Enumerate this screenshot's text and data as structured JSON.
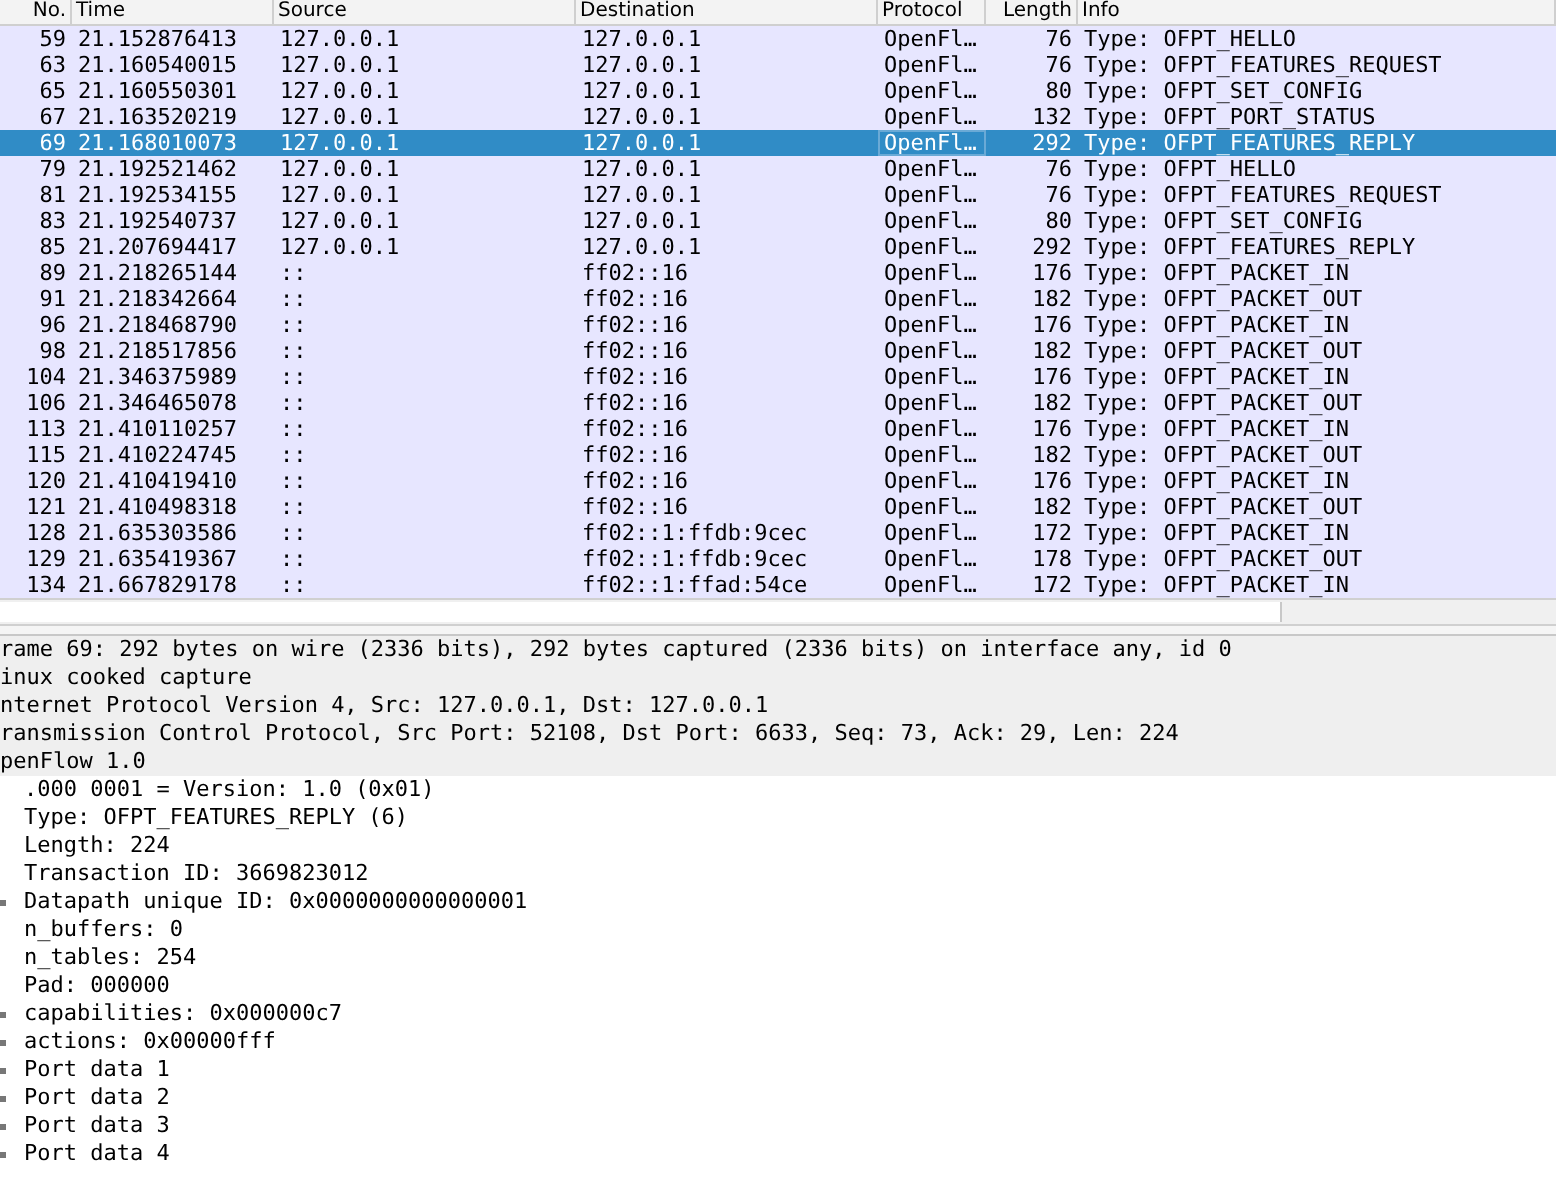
{
  "packet_list": {
    "columns": [
      "No.",
      "Time",
      "Source",
      "Destination",
      "Protocol",
      "Length",
      "Info"
    ],
    "rows": [
      {
        "no": "59",
        "time": "21.152876413",
        "source": "127.0.0.1",
        "destination": "127.0.0.1",
        "protocol": "OpenFl…",
        "length": "76",
        "info": "Type: OFPT_HELLO",
        "selected": false
      },
      {
        "no": "63",
        "time": "21.160540015",
        "source": "127.0.0.1",
        "destination": "127.0.0.1",
        "protocol": "OpenFl…",
        "length": "76",
        "info": "Type: OFPT_FEATURES_REQUEST",
        "selected": false
      },
      {
        "no": "65",
        "time": "21.160550301",
        "source": "127.0.0.1",
        "destination": "127.0.0.1",
        "protocol": "OpenFl…",
        "length": "80",
        "info": "Type: OFPT_SET_CONFIG",
        "selected": false
      },
      {
        "no": "67",
        "time": "21.163520219",
        "source": "127.0.0.1",
        "destination": "127.0.0.1",
        "protocol": "OpenFl…",
        "length": "132",
        "info": "Type: OFPT_PORT_STATUS",
        "selected": false
      },
      {
        "no": "69",
        "time": "21.168010073",
        "source": "127.0.0.1",
        "destination": "127.0.0.1",
        "protocol": "OpenFl…",
        "length": "292",
        "info": "Type: OFPT_FEATURES_REPLY",
        "selected": true
      },
      {
        "no": "79",
        "time": "21.192521462",
        "source": "127.0.0.1",
        "destination": "127.0.0.1",
        "protocol": "OpenFl…",
        "length": "76",
        "info": "Type: OFPT_HELLO",
        "selected": false
      },
      {
        "no": "81",
        "time": "21.192534155",
        "source": "127.0.0.1",
        "destination": "127.0.0.1",
        "protocol": "OpenFl…",
        "length": "76",
        "info": "Type: OFPT_FEATURES_REQUEST",
        "selected": false
      },
      {
        "no": "83",
        "time": "21.192540737",
        "source": "127.0.0.1",
        "destination": "127.0.0.1",
        "protocol": "OpenFl…",
        "length": "80",
        "info": "Type: OFPT_SET_CONFIG",
        "selected": false
      },
      {
        "no": "85",
        "time": "21.207694417",
        "source": "127.0.0.1",
        "destination": "127.0.0.1",
        "protocol": "OpenFl…",
        "length": "292",
        "info": "Type: OFPT_FEATURES_REPLY",
        "selected": false
      },
      {
        "no": "89",
        "time": "21.218265144",
        "source": "::",
        "destination": "ff02::16",
        "protocol": "OpenFl…",
        "length": "176",
        "info": "Type: OFPT_PACKET_IN",
        "selected": false
      },
      {
        "no": "91",
        "time": "21.218342664",
        "source": "::",
        "destination": "ff02::16",
        "protocol": "OpenFl…",
        "length": "182",
        "info": "Type: OFPT_PACKET_OUT",
        "selected": false
      },
      {
        "no": "96",
        "time": "21.218468790",
        "source": "::",
        "destination": "ff02::16",
        "protocol": "OpenFl…",
        "length": "176",
        "info": "Type: OFPT_PACKET_IN",
        "selected": false
      },
      {
        "no": "98",
        "time": "21.218517856",
        "source": "::",
        "destination": "ff02::16",
        "protocol": "OpenFl…",
        "length": "182",
        "info": "Type: OFPT_PACKET_OUT",
        "selected": false
      },
      {
        "no": "104",
        "time": "21.346375989",
        "source": "::",
        "destination": "ff02::16",
        "protocol": "OpenFl…",
        "length": "176",
        "info": "Type: OFPT_PACKET_IN",
        "selected": false
      },
      {
        "no": "106",
        "time": "21.346465078",
        "source": "::",
        "destination": "ff02::16",
        "protocol": "OpenFl…",
        "length": "182",
        "info": "Type: OFPT_PACKET_OUT",
        "selected": false
      },
      {
        "no": "113",
        "time": "21.410110257",
        "source": "::",
        "destination": "ff02::16",
        "protocol": "OpenFl…",
        "length": "176",
        "info": "Type: OFPT_PACKET_IN",
        "selected": false
      },
      {
        "no": "115",
        "time": "21.410224745",
        "source": "::",
        "destination": "ff02::16",
        "protocol": "OpenFl…",
        "length": "182",
        "info": "Type: OFPT_PACKET_OUT",
        "selected": false
      },
      {
        "no": "120",
        "time": "21.410419410",
        "source": "::",
        "destination": "ff02::16",
        "protocol": "OpenFl…",
        "length": "176",
        "info": "Type: OFPT_PACKET_IN",
        "selected": false
      },
      {
        "no": "121",
        "time": "21.410498318",
        "source": "::",
        "destination": "ff02::16",
        "protocol": "OpenFl…",
        "length": "182",
        "info": "Type: OFPT_PACKET_OUT",
        "selected": false
      },
      {
        "no": "128",
        "time": "21.635303586",
        "source": "::",
        "destination": "ff02::1:ffdb:9cec",
        "protocol": "OpenFl…",
        "length": "172",
        "info": "Type: OFPT_PACKET_IN",
        "selected": false
      },
      {
        "no": "129",
        "time": "21.635419367",
        "source": "::",
        "destination": "ff02::1:ffdb:9cec",
        "protocol": "OpenFl…",
        "length": "178",
        "info": "Type: OFPT_PACKET_OUT",
        "selected": false
      },
      {
        "no": "134",
        "time": "21.667829178",
        "source": "::",
        "destination": "ff02::1:ffad:54ce",
        "protocol": "OpenFl…",
        "length": "172",
        "info": "Type: OFPT_PACKET_IN",
        "selected": false
      }
    ]
  },
  "packet_details": [
    {
      "text": "rame 69: 292 bytes on wire (2336 bits), 292 bytes captured (2336 bits) on interface any, id 0"
    },
    {
      "text": "inux cooked capture"
    },
    {
      "text": "nternet Protocol Version 4, Src: 127.0.0.1, Dst: 127.0.0.1"
    },
    {
      "text": "ransmission Control Protocol, Src Port: 52108, Dst Port: 6633, Seq: 73, Ack: 29, Len: 224"
    },
    {
      "text": "penFlow 1.0",
      "children": [
        {
          "text": ".000 0001 = Version: 1.0 (0x01)",
          "expandable": false
        },
        {
          "text": "Type: OFPT_FEATURES_REPLY (6)",
          "expandable": false
        },
        {
          "text": "Length: 224",
          "expandable": false
        },
        {
          "text": "Transaction ID: 3669823012",
          "expandable": false
        },
        {
          "text": "Datapath unique ID: 0x0000000000000001",
          "expandable": true
        },
        {
          "text": "n_buffers: 0",
          "expandable": false
        },
        {
          "text": "n_tables: 254",
          "expandable": false
        },
        {
          "text": "Pad: 000000",
          "expandable": false
        },
        {
          "text": "capabilities: 0x000000c7",
          "expandable": true
        },
        {
          "text": "actions: 0x00000fff",
          "expandable": true
        },
        {
          "text": "Port data 1",
          "expandable": true
        },
        {
          "text": "Port data 2",
          "expandable": true
        },
        {
          "text": "Port data 3",
          "expandable": true
        },
        {
          "text": "Port data 4",
          "expandable": true
        }
      ]
    }
  ]
}
